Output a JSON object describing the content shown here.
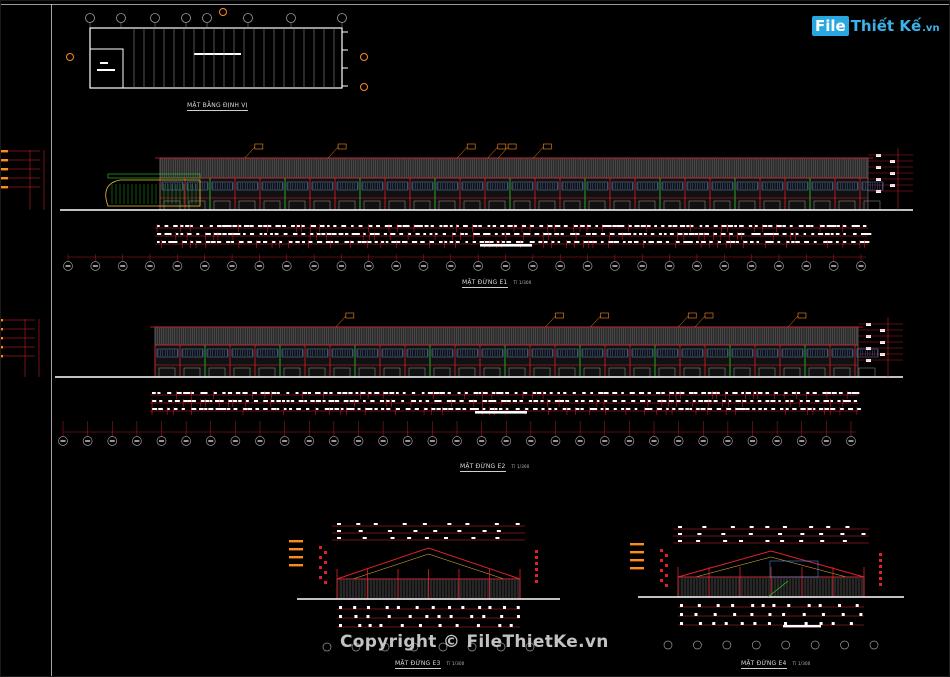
{
  "drawing": {
    "background": "#000000",
    "colors": {
      "red": "#e0212b",
      "white": "#ffffff",
      "grey": "#9a9a9a",
      "green": "#2fd12f",
      "yellow": "#f1c232",
      "orange": "#ff8c1a",
      "blue": "#4da3ff",
      "magenta": "#ff44ff"
    },
    "site_plan": {
      "label": "MẶT BẰNG ĐỊNH VỊ"
    },
    "elevation_e1": {
      "label": "MẶT ĐỨNG E1",
      "scale": "Tỉ 1/300"
    },
    "elevation_e2": {
      "label": "MẶT ĐỨNG E2",
      "scale": "Tỉ 1/300"
    },
    "elevation_e3": {
      "label": "MẶT ĐỨNG E3",
      "scale": "Tỉ 1/300"
    },
    "elevation_e4": {
      "label": "MẶT ĐỨNG E4",
      "scale": "Tỉ 1/300"
    }
  },
  "logo": {
    "box": "File",
    "name": "Thiết Kế",
    "domain": ".vn"
  },
  "watermark": {
    "text": "Copyright © FileThietKe.vn"
  }
}
